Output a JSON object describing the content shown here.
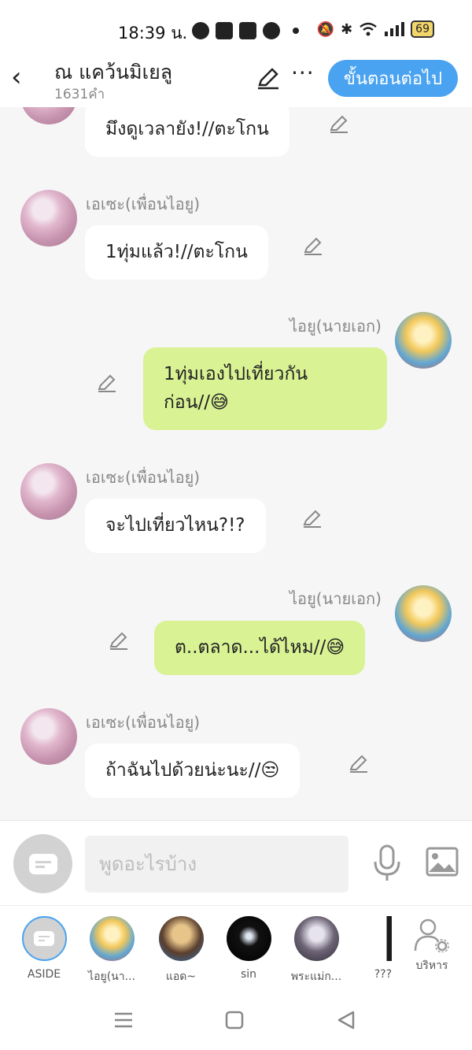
{
  "status_bar": {
    "time": "18:39 น.",
    "battery": "69",
    "icons": [
      "messenger-icon",
      "line-icon",
      "app-icon",
      "penguin-icon",
      "dot-icon",
      "mute-icon",
      "bluetooth-icon",
      "wifi-icon",
      "signal-icon"
    ]
  },
  "header": {
    "back_label": "‹",
    "title": "ณ แคว้นมิเยลู",
    "subtitle": "1631คำ",
    "more_label": "···",
    "next_label": "ขั้นตอนต่อไป"
  },
  "messages": [
    {
      "sender": "",
      "side": "left",
      "text": "มึงดูเวลายัง!//ตะโกน"
    },
    {
      "sender": "เอเซะ(เพื่อนไอยู)",
      "side": "left",
      "text": "1ทุ่มแล้ว!//ตะโกน"
    },
    {
      "sender": "ไอยู(นายเอก)",
      "side": "right",
      "text_line1": "1ทุ่มเองไปเที่ยวกัน",
      "text_line2": "ก่อน//😅"
    },
    {
      "sender": "เอเซะ(เพื่อนไอยู)",
      "side": "left",
      "text": "จะไปเที่ยวไหน?!?"
    },
    {
      "sender": "ไอยู(นายเอก)",
      "side": "right",
      "text": "ต..ตลาด...ได้ไหม//😅"
    },
    {
      "sender": "เอเซะ(เพื่อนไอยู)",
      "side": "left",
      "text": "ถ้าฉันไปด้วยน่ะนะ//😒"
    }
  ],
  "input": {
    "placeholder": "พูดอะไรบ้าง"
  },
  "characters": [
    {
      "label": "ASIDE"
    },
    {
      "label": "ไอยู(นา..."
    },
    {
      "label": "แอด~"
    },
    {
      "label": "sin"
    },
    {
      "label": "พระแม่ก..."
    },
    {
      "label": "???"
    },
    {
      "label": "บริหาร"
    }
  ],
  "colors": {
    "accent": "#4aa3f0",
    "right_bubble": "#d8f294",
    "left_bubble": "#ffffff"
  }
}
